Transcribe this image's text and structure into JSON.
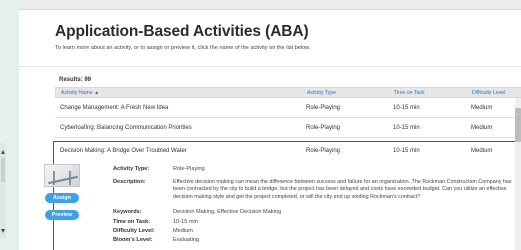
{
  "page": {
    "title": "Application-Based Activities (ABA)",
    "intro": "To learn more about an activity, or to assign or preview it, click the name of the activity on the list below."
  },
  "results_label": "Results: 99",
  "table": {
    "headers": [
      "Activity Name ▲",
      "Activity Type",
      "Time on Task",
      "Difficulty Level"
    ],
    "rows": [
      {
        "name": "Change Management: A Fresh New Idea",
        "type": "Role-Playing",
        "time": "10-15 min",
        "level": "Medium"
      },
      {
        "name": "Cyberloafing: Balancing Communication Priorities",
        "type": "Role-Playing",
        "time": "10-15 min",
        "level": "Medium"
      }
    ],
    "expanded": {
      "name": "Decision Making: A Bridge Over Troubled Water",
      "type": "Role-Playing",
      "time": "10-15 min",
      "level": "Medium",
      "details": {
        "activity_type_label": "Activity Type:",
        "activity_type": "Role-Playing",
        "description_label": "Description:",
        "description": "Effective decision making can mean the difference between success and failure for an organization. The Rockman Construction Company has been contracted by the city to build a bridge, but the project has been delayed and costs have exceeded budget. Can you utilize an effective decision making style and get the project completed, or will the city end up voiding Rockman's contract?",
        "keywords_label": "Keywords:",
        "keywords": "Decision Making, Effective Decision Making",
        "time_label": "Time on Task:",
        "time": "10-15 min",
        "difficulty_label": "Difficulty Level:",
        "difficulty": "Medium",
        "blooms_label": "Bloom's Level:",
        "blooms": "Evaluating"
      },
      "assign_label": "Assign",
      "preview_label": "Preview"
    }
  }
}
